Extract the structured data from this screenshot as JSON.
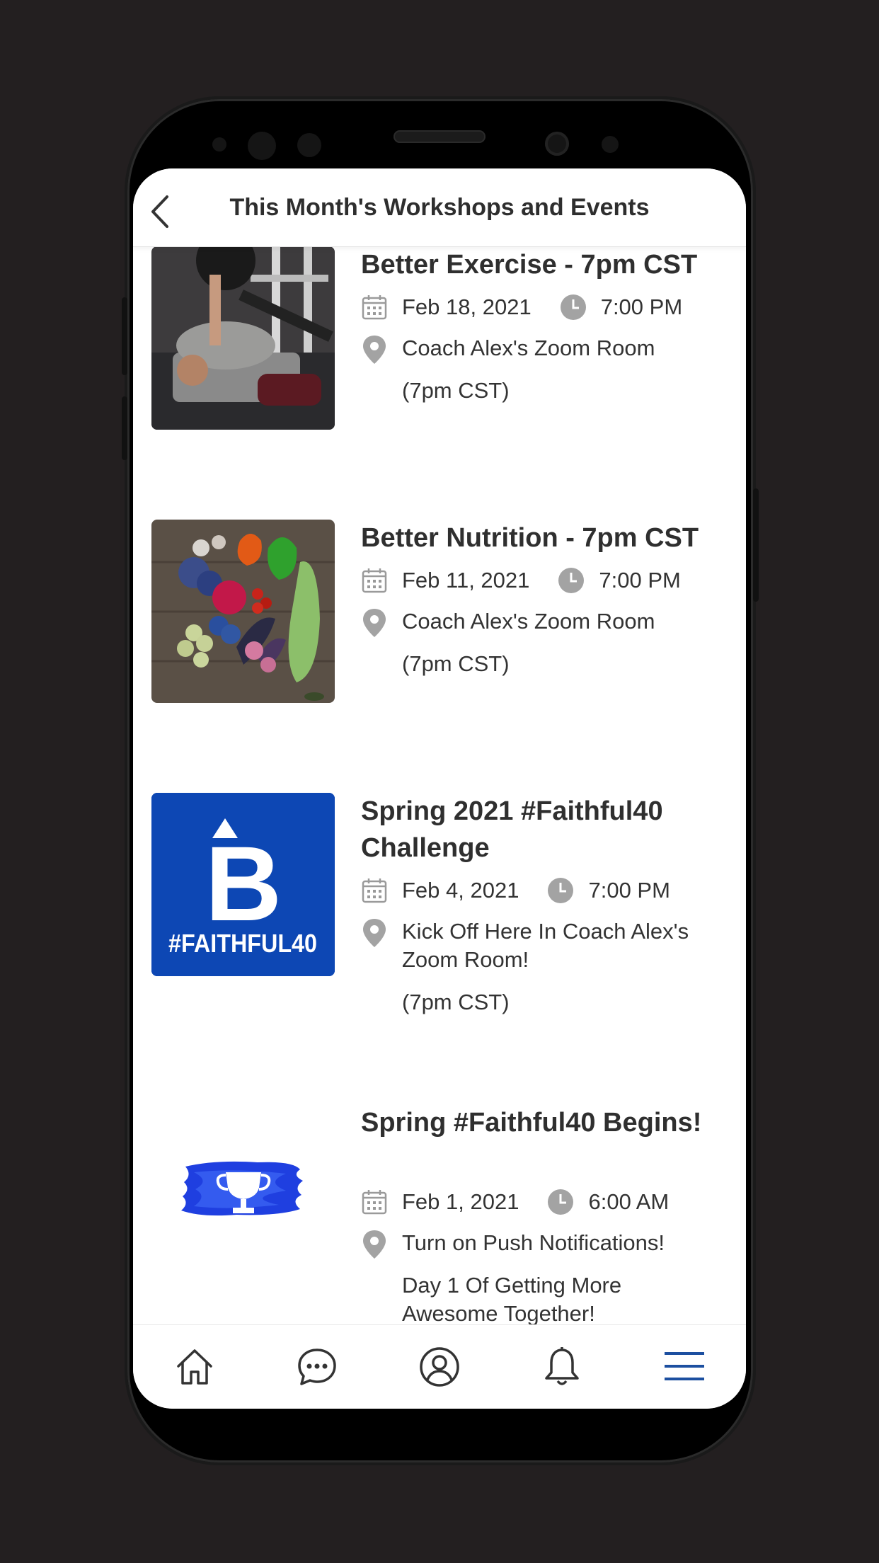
{
  "header": {
    "title": "This Month's Workshops and Events"
  },
  "events": [
    {
      "title": "Better Exercise - 7pm CST",
      "date": "Feb 18, 2021",
      "time": "7:00 PM",
      "location": "Coach Alex's Zoom Room",
      "note": "(7pm CST)"
    },
    {
      "title": "Better Nutrition - 7pm CST",
      "date": "Feb 11, 2021",
      "time": "7:00 PM",
      "location": "Coach Alex's Zoom Room",
      "note": "(7pm CST)"
    },
    {
      "title": "Spring 2021 #Faithful40 Challenge",
      "date": "Feb 4, 2021",
      "time": "7:00 PM",
      "location": "Kick Off Here In Coach Alex's Zoom Room!",
      "note": "(7pm CST)",
      "logo_text": "#FAITHFUL40",
      "logo_letter": "B"
    },
    {
      "title": "Spring #Faithful40 Begins!",
      "date": "Feb 1, 2021",
      "time": "6:00 AM",
      "location": "Turn on Push Notifications!",
      "note": "Day 1 Of Getting More Awesome Together!"
    }
  ],
  "nav": {
    "tabs": [
      "home-icon",
      "chat-icon",
      "profile-icon",
      "bell-icon",
      "menu-icon"
    ],
    "active": "menu-icon"
  },
  "colors": {
    "brand_blue": "#0d47b4",
    "active_nav": "#1c4fa0",
    "icon_gray": "#9a9a9a",
    "text": "#2f2f2f",
    "bezel": "#000000",
    "background": "#231f20"
  }
}
